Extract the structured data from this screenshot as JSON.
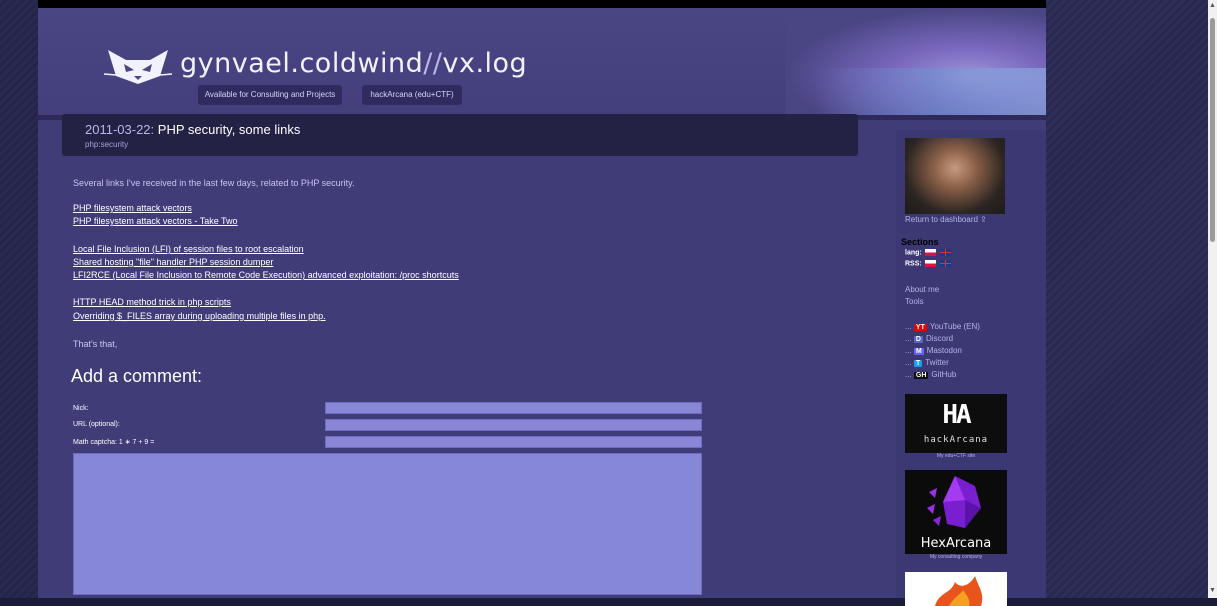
{
  "site": {
    "title_main": "gynvael.coldwind",
    "title_slash": "//",
    "title_suffix": "vx.log",
    "nav": [
      "Available for Consulting and Projects",
      "hackArcana (edu+CTF)"
    ]
  },
  "post": {
    "date": "2011-03-22:",
    "title": "PHP security, some links",
    "tag": "php:security",
    "intro": "Several links I've received in the last few days, related to PHP security.",
    "links": [
      "PHP filesystem attack vectors",
      "PHP filesystem attack vectors - Take Two",
      "Local File Inclusion (LFI) of session files to root escalation",
      "Shared hosting \"file\" handler PHP session dumper",
      "LFI2RCE (Local File Inclusion to Remote Code Execution) advanced exploitation: /proc shortcuts",
      "HTTP HEAD method trick in php scripts",
      "Overriding $_FILES array during uploading multiple files in php."
    ],
    "outro": "That's that,"
  },
  "comment_form": {
    "heading": "Add a comment:",
    "nick_label": "Nick:",
    "url_label": "URL (optional):",
    "captcha_label": "Math captcha: 1 ∗ 7 + 9 ="
  },
  "sidebar": {
    "return_label": "Return to dashboard ⇪",
    "sections_label": "Sections",
    "lang_label": "lang:",
    "rss_label": "RSS:",
    "about_label": "About me",
    "tools_label": "Tools",
    "social": [
      {
        "badge": "YT",
        "label": "YouTube (EN)"
      },
      {
        "badge": "D",
        "label": "Discord"
      },
      {
        "badge": "M",
        "label": "Mastodon"
      },
      {
        "badge": "T",
        "label": "Twitter"
      },
      {
        "badge": "GH",
        "label": "GitHub"
      }
    ],
    "social_prefix": "...",
    "hackarcana_symbol": "HA",
    "hackarcana_text": "hackArcana",
    "hackarcana_caption": "My edu+CTF site",
    "hexarcana_text": "HexArcana",
    "hexarcana_caption": "My consulting company"
  },
  "colors": {
    "page_bg": "#403c78",
    "header_bg": "#4a4684",
    "post_header_bg": "#232244",
    "input_bg": "#8a86d6",
    "link": "#ffffff"
  }
}
